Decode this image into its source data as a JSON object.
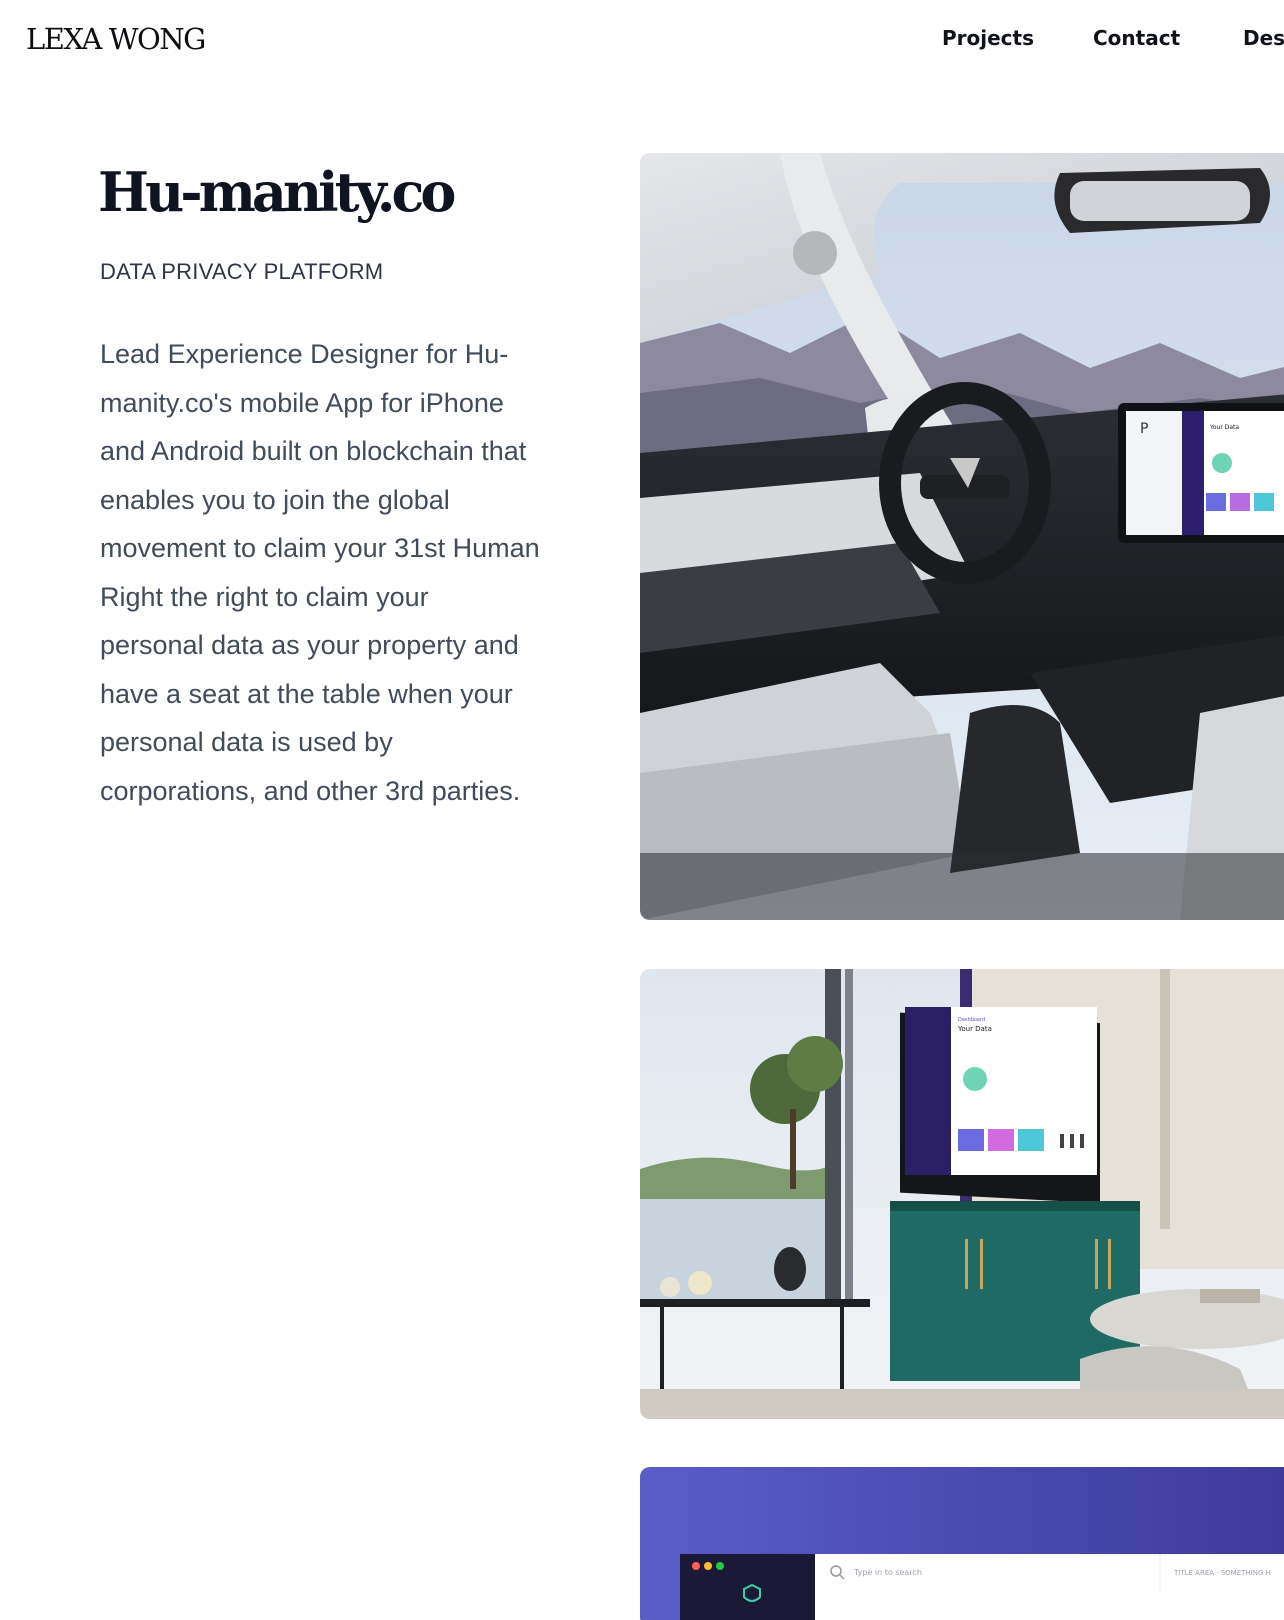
{
  "header": {
    "logo": "LEXA WONG",
    "nav": [
      {
        "label": "Projects"
      },
      {
        "label": "Contact"
      },
      {
        "label": "Desi"
      }
    ]
  },
  "project": {
    "title": "Hu-manity.co",
    "subtitle": "DATA PRIVACY PLATFORM",
    "description_lines": [
      "Lead Experience Designer for Hu-",
      "manity.co's mobile App for iPhone",
      "and Android built on blockchain that",
      "enables you to join the global",
      "movement to claim your 31st Human",
      "Right the right to claim your",
      "personal data as your property and",
      "have a seat at the table when your",
      "personal data is used by",
      "corporations, and other 3rd parties."
    ]
  },
  "images": {
    "car": {
      "screen_title": "Your Data",
      "screen_greeting": "P"
    },
    "tv": {
      "screen_greeting": "Dashboard",
      "screen_title": "Your Data"
    },
    "app": {
      "search_placeholder": "Type in to search",
      "right_label": "TITLE AREA · SOMETHING H"
    }
  },
  "colors": {
    "accent_purple": "#5a4fc6",
    "dark_navy": "#1e1748",
    "teal_cabinet": "#1e6b64"
  }
}
